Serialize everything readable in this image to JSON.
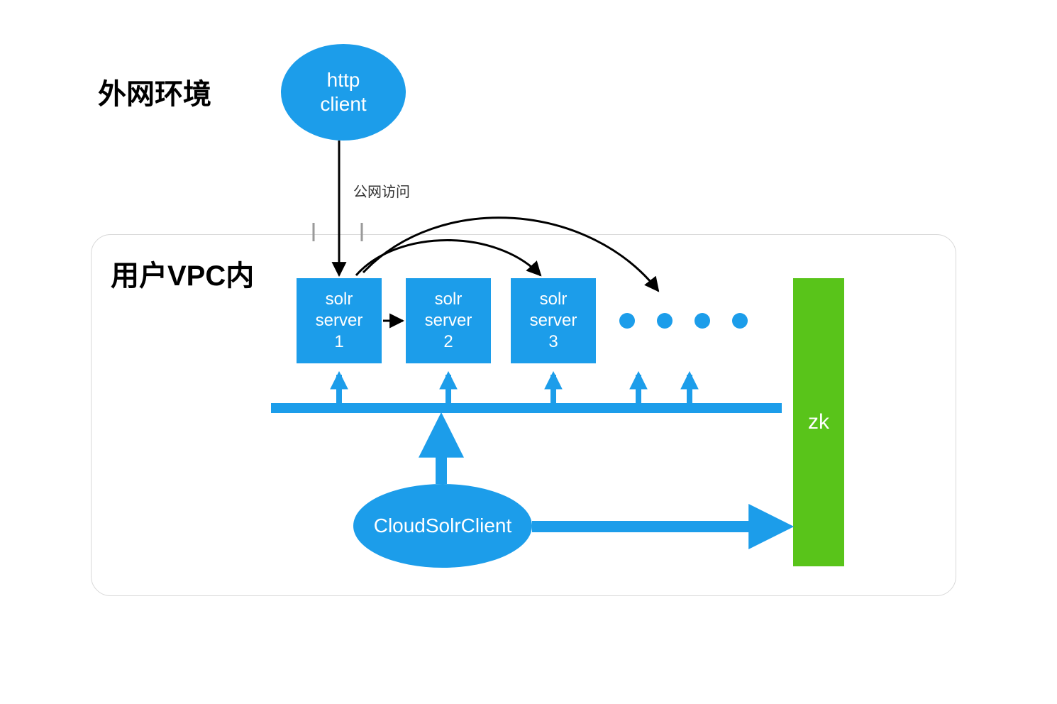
{
  "labels": {
    "external_env": "外网环境",
    "user_vpc": "用户VPC内",
    "public_access": "公网访问"
  },
  "nodes": {
    "http_client": "http\nclient",
    "cloud_solr_client": "CloudSolrClient",
    "zk": "zk",
    "solr1": "solr\nserver\n1",
    "solr2": "solr\nserver\n2",
    "solr3": "solr\nserver\n3"
  },
  "colors": {
    "blue": "#1C9DEA",
    "green": "#59C41A",
    "black": "#000000",
    "border": "#d8d8d8"
  }
}
